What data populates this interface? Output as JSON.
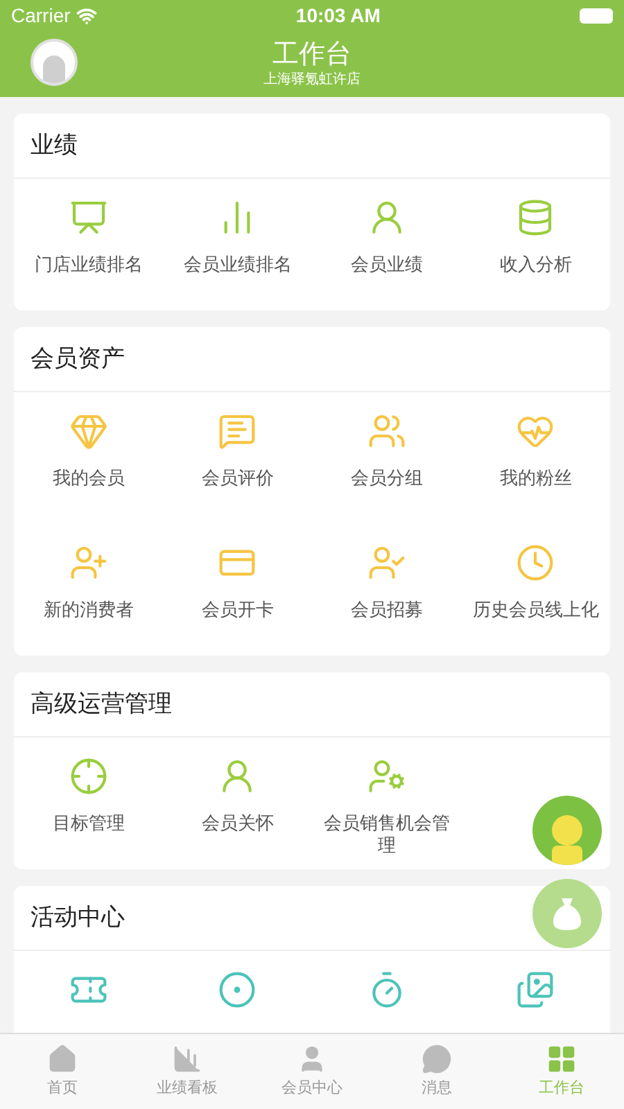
{
  "status_bar": {
    "carrier": "Carrier",
    "time": "10:03 AM"
  },
  "nav": {
    "title": "工作台",
    "subtitle": "上海驿氪虹许店"
  },
  "sections": [
    {
      "title": "业绩",
      "color": "#9acd3f",
      "items": [
        {
          "label": "门店业绩排名"
        },
        {
          "label": "会员业绩排名"
        },
        {
          "label": "会员业绩"
        },
        {
          "label": "收入分析"
        }
      ]
    },
    {
      "title": "会员资产",
      "color": "#f5c542",
      "items": [
        {
          "label": "我的会员"
        },
        {
          "label": "会员评价"
        },
        {
          "label": "会员分组"
        },
        {
          "label": "我的粉丝"
        },
        {
          "label": "新的消费者"
        },
        {
          "label": "会员开卡"
        },
        {
          "label": "会员招募"
        },
        {
          "label": "历史会员线上化"
        }
      ]
    },
    {
      "title": "高级运营管理",
      "color": "#9acd3f",
      "items": [
        {
          "label": "目标管理"
        },
        {
          "label": "会员关怀"
        },
        {
          "label": "会员销售机会管理"
        }
      ]
    },
    {
      "title": "活动中心",
      "color": "#4cc3b9",
      "items": [
        {
          "kind": "icon"
        },
        {
          "kind": "icon"
        },
        {
          "kind": "icon"
        },
        {
          "kind": "icon"
        }
      ]
    }
  ],
  "tabs": [
    {
      "label": "首页",
      "selected": false
    },
    {
      "label": "业绩看板",
      "selected": false
    },
    {
      "label": "会员中心",
      "selected": false
    },
    {
      "label": "消息",
      "selected": false
    },
    {
      "label": "工作台",
      "selected": true
    }
  ]
}
